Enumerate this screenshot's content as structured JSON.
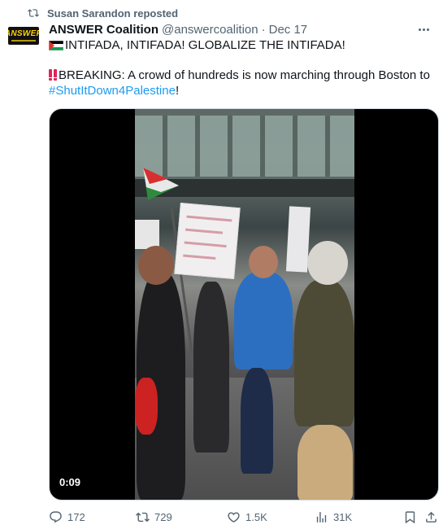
{
  "repost": {
    "label": "Susan Sarandon reposted",
    "icon": "repost-icon"
  },
  "author": {
    "avatar_text": "ANSWER",
    "name": "ANSWER Coalition",
    "handle": "@answercoalition",
    "separator": "·",
    "date": "Dec 17"
  },
  "tweet": {
    "line1_icon": "palestine-flag-icon",
    "line1": "INTIFADA, INTIFADA! GLOBALIZE THE INTIFADA!",
    "line2_icon": "double-exclamation-icon",
    "line2": "BREAKING: A crowd of hundreds is now marching through Boston to",
    "hashtag": "#ShutItDown4Palestine",
    "line3_suffix": "!"
  },
  "media": {
    "duration": "0:09"
  },
  "actions": {
    "replies": "172",
    "reposts": "729",
    "likes": "1.5K",
    "views": "31K"
  },
  "colors": {
    "accent": "#1d9bf0",
    "muted": "#536471",
    "text": "#0f1419",
    "alert": "#e0245e"
  }
}
